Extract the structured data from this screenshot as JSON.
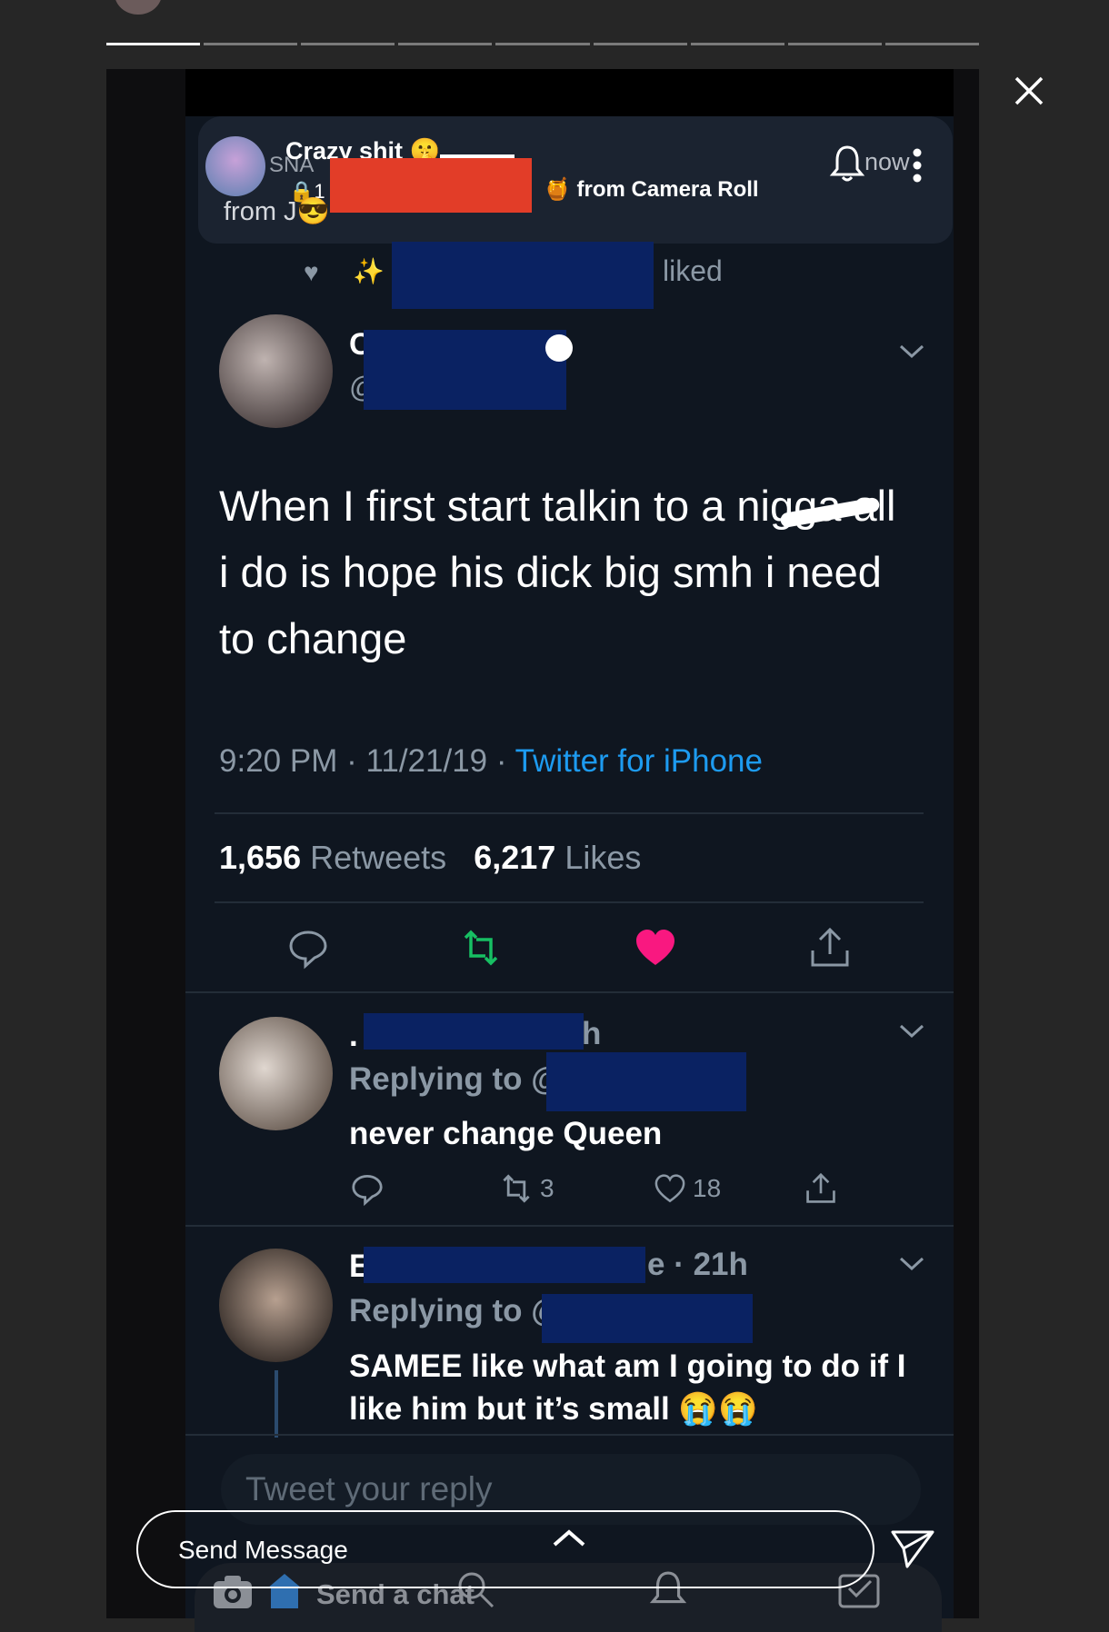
{
  "story": {
    "progress_total": 9,
    "progress_active_index": 0,
    "send_placeholder": "Send Message"
  },
  "snap_header": {
    "title": "Crazy shit 🤫",
    "sub_prefix": "SNA",
    "lock_prefix": "1",
    "from_prefix": "from J😎",
    "camera_roll": "🍯 from Camera Roll",
    "time": "now"
  },
  "tweet": {
    "liked_suffix": "liked",
    "name_initial": "C",
    "handle_initial": "@",
    "text": "When I first start talkin to a nigga all i do is hope his dick big smh i need to change",
    "time": "9:20 PM",
    "date": "11/21/19",
    "source": "Twitter for iPhone",
    "retweets_count": "1,656",
    "retweets_label": "Retweets",
    "likes_count": "6,217",
    "likes_label": "Likes"
  },
  "replies": [
    {
      "name_initial": ".",
      "name_suffix": "h",
      "replying_to": "Replying to @",
      "text": "never change Queen",
      "retweets": "3",
      "likes": "18"
    },
    {
      "name_initial": "E",
      "name_suffix": "e · 21h",
      "replying_to": "Replying to @",
      "text": "SAMEE like what am I going to do if I like him but it’s small 😭😭"
    }
  ],
  "reply_box_placeholder": "Tweet your reply",
  "snap_bottom": {
    "send_chat": "Send a chat"
  },
  "colors": {
    "twitter_blue": "#1d9bf0",
    "like_pink": "#f91880",
    "retweet_green": "#17bf63"
  }
}
